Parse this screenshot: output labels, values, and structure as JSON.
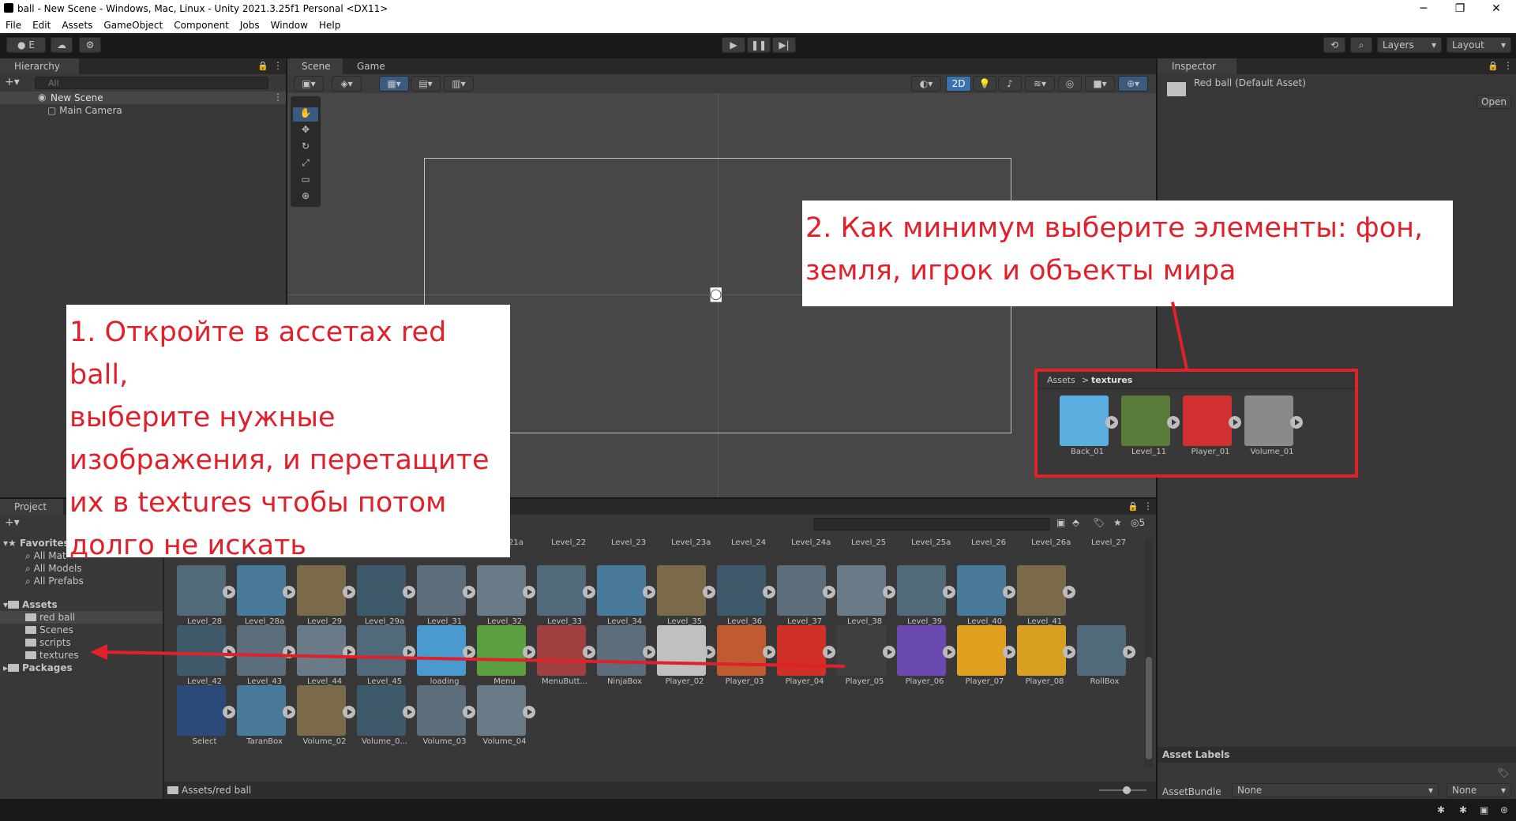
{
  "window": {
    "title": "ball - New Scene - Windows, Mac, Linux - Unity 2021.3.25f1 Personal <DX11>",
    "minimize": "─",
    "restore": "❐",
    "close": "✕"
  },
  "menu": [
    "File",
    "Edit",
    "Assets",
    "GameObject",
    "Component",
    "Jobs",
    "Window",
    "Help"
  ],
  "toolbar": {
    "account": "E",
    "layers": "Layers",
    "layout": "Layout"
  },
  "hierarchy": {
    "tab": "Hierarchy",
    "search_placeholder": "All",
    "scene": "New Scene",
    "items": [
      "Main Camera"
    ]
  },
  "scene": {
    "tab_scene": "Scene",
    "tab_game": "Game",
    "mode_2d": "2D"
  },
  "inspector": {
    "tab": "Inspector",
    "asset_name": "Red ball (Default Asset)",
    "open_button": "Open",
    "asset_labels": "Asset Labels",
    "assetbundle_label": "AssetBundle",
    "assetbundle_value": "None",
    "variant_value": "None"
  },
  "project": {
    "tab": "Project",
    "favorites": "Favorites",
    "fav_items": [
      "All Mat",
      "All Models",
      "All Prefabs"
    ],
    "assets": "Assets",
    "folders": [
      "red ball",
      "Scenes",
      "scripts",
      "textures"
    ],
    "packages": "Packages",
    "path": "Assets/red ball",
    "hidden_count": "5",
    "top_labels": [
      "21a",
      "Level_22",
      "Level_23",
      "Level_23a",
      "Level_24",
      "Level_24a",
      "Level_25",
      "Level_25a",
      "Level_26",
      "Level_26a",
      "Level_27"
    ],
    "rows": [
      [
        "Level_28",
        "Level_28a",
        "Level_29",
        "Level_29a",
        "Level_31",
        "Level_32",
        "Level_33",
        "Level_34",
        "Level_35",
        "Level_36",
        "Level_37",
        "Level_38",
        "Level_39",
        "Level_40",
        "Level_41"
      ],
      [
        "Level_42",
        "Level_43",
        "Level_44",
        "Level_45",
        "loading",
        "Menu",
        "MenuButt...",
        "NinjaBox",
        "Player_02",
        "Player_03",
        "Player_04",
        "Player_05",
        "Player_06",
        "Player_07",
        "Player_08",
        "RollBox"
      ],
      [
        "Select",
        "TaranBox",
        "Volume_02",
        "Volume_0...",
        "Volume_03",
        "Volume_04"
      ]
    ]
  },
  "annotation1": {
    "lines": [
      "1. Откройте в ассетах red ball,",
      "выберите нужные",
      "изображения, и перетащите",
      "их в textures чтобы потом",
      "долго не искать"
    ]
  },
  "annotation2": {
    "lines": [
      "2. Как минимум выберите элементы: фон,",
      "земля, игрок и объекты мира"
    ]
  },
  "inset": {
    "breadcrumb_root": "Assets",
    "breadcrumb_sep": ">",
    "breadcrumb_leaf": "textures",
    "items": [
      "Back_01",
      "Level_11",
      "Player_01",
      "Volume_01"
    ]
  },
  "colors": {
    "annotation_red": "#e0202a",
    "accent_blue": "#3a72b0"
  }
}
